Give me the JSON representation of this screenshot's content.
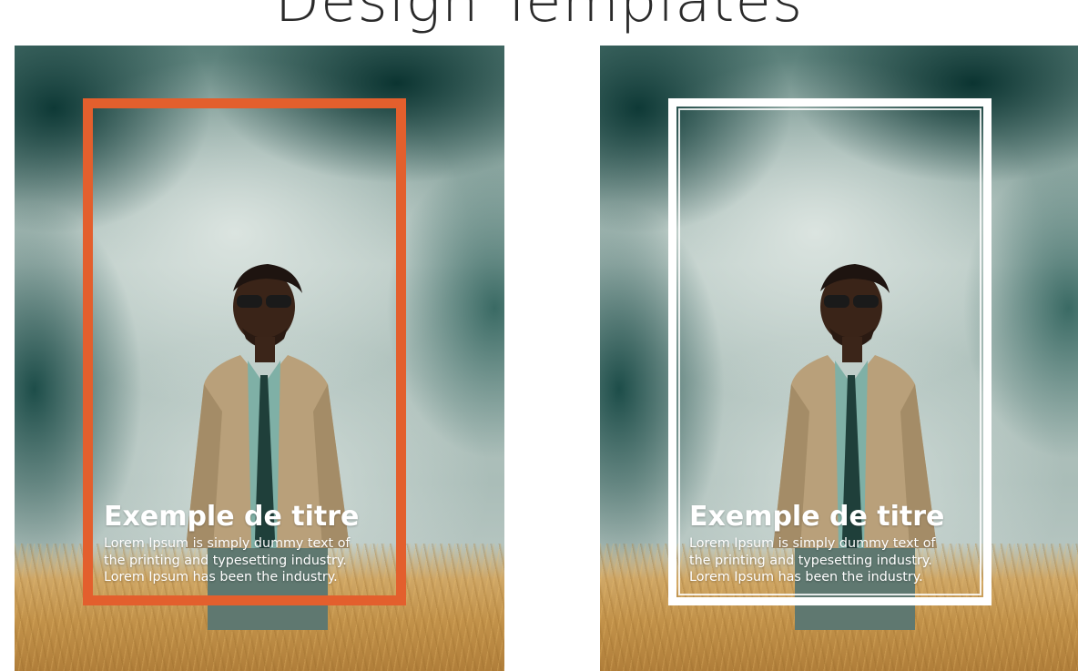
{
  "header": {
    "title": "Design Templates"
  },
  "panels": [
    {
      "frame_color": "#e35f2d",
      "title": "Exemple de titre",
      "body_line1": "Lorem Ipsum is simply dummy text of",
      "body_line2": "the printing and typesetting industry.",
      "body_line3": "Lorem Ipsum has been the industry."
    },
    {
      "frame_color": "#ffffff",
      "title": "Exemple de titre",
      "body_line1": "Lorem Ipsum is simply dummy text of",
      "body_line2": "the printing and typesetting industry.",
      "body_line3": "Lorem Ipsum has been the industry."
    }
  ]
}
